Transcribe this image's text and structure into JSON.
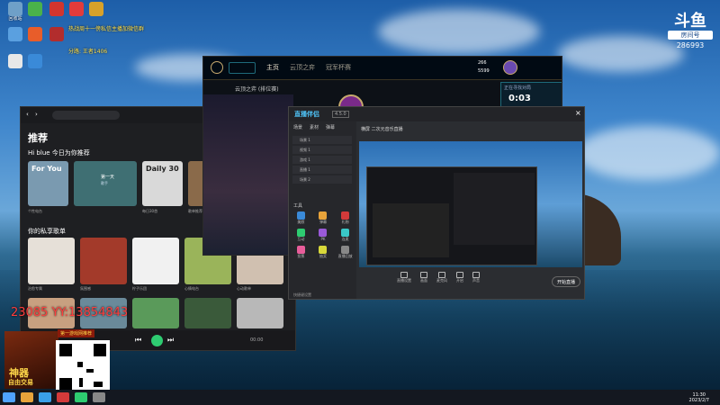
{
  "desktop": {
    "icons": [
      {
        "label": "回收站",
        "color": "#6fa0c8"
      },
      {
        "label": "",
        "color": "#4ab24a"
      },
      {
        "label": "",
        "color": "#d2352e"
      },
      {
        "label": "",
        "color": "#e23b3b"
      },
      {
        "label": "",
        "color": "#d7a12a"
      },
      {
        "label": "",
        "color": "#5aa0e0"
      },
      {
        "label": "",
        "color": "#e85d2a"
      },
      {
        "label": "",
        "color": "#b22d2d"
      },
      {
        "label": "",
        "color": "#e8e8e8"
      },
      {
        "label": "",
        "color": "#3a8ad8"
      }
    ]
  },
  "overlay": {
    "notice_line1": "热战周十一傍私信主播加微信群",
    "notice_line2": "分路:  王者1406",
    "watermark": "23085  YY:13854843",
    "room_label": "房间号",
    "room_number": "286993",
    "ad_top": "第一游戏网推荐",
    "ad_title_1": "神器",
    "ad_title_2": "自由交易"
  },
  "music": {
    "heading": "推荐",
    "greeting": "Hi blue 今日为你推荐",
    "section_private": "你的私享歌单",
    "search_placeholder": "搜索",
    "cards_row1": [
      {
        "title": "For You",
        "caption": "个性电台",
        "color": "#7a9ab0"
      },
      {
        "title": "",
        "caption": "",
        "color": "#3f6f73",
        "wide": true,
        "line1": "第一天",
        "line2": "歌手"
      },
      {
        "title": "Daily 30",
        "caption": "每日30首",
        "color": "#d9d9d9"
      },
      {
        "title": "",
        "caption": "歌单推荐",
        "color": "#8a6a4a"
      }
    ],
    "cards_row2": [
      {
        "caption": "治愈专属",
        "color": "#e6e0d8"
      },
      {
        "caption": "氛围感",
        "color": "#a33a2a"
      },
      {
        "caption": "柠子乐团",
        "color": "#f1f1f1"
      },
      {
        "caption": "心情电台",
        "color": "#9ab45a"
      },
      {
        "caption": "心动歌单",
        "color": "#d0c0b0"
      }
    ],
    "cards_row3": [
      {
        "color": "#c8a080"
      },
      {
        "color": "#6a8a9a"
      },
      {
        "color": "#5a9a5a"
      },
      {
        "color": "#3a5a3a"
      },
      {
        "color": "#b8b8b8"
      }
    ],
    "player_time": "00:00"
  },
  "game": {
    "tabs": [
      "主页",
      "云顶之弈",
      "冠军杯赛"
    ],
    "subtitle": "云顶之弈 (排位赛)",
    "stat1": "266",
    "stat2": "5599",
    "timer": "0:03",
    "timer_label": "正在寻找对局"
  },
  "obs": {
    "logo_text": "直播伴侣",
    "version": "4.5.0",
    "tabs": [
      "场景",
      "素材",
      "弹幕"
    ],
    "scenes": [
      "场景 1",
      "视频 1",
      "游戏 1",
      "直播 1",
      "场景 2"
    ],
    "tools_label": "工具",
    "tools": [
      "美颜",
      "弹幕",
      "礼物",
      "互动",
      "PK",
      "连麦",
      "投票",
      "抽奖",
      "直播回放"
    ],
    "tip": "快捷键设置",
    "title": "横屏 二次元音乐直播",
    "controls": [
      "直播设置",
      "画面",
      "麦克风",
      "开启",
      "声音"
    ],
    "start_btn": "开始直播"
  },
  "taskbar": {
    "time": "11:30",
    "date": "2023/2/7"
  }
}
